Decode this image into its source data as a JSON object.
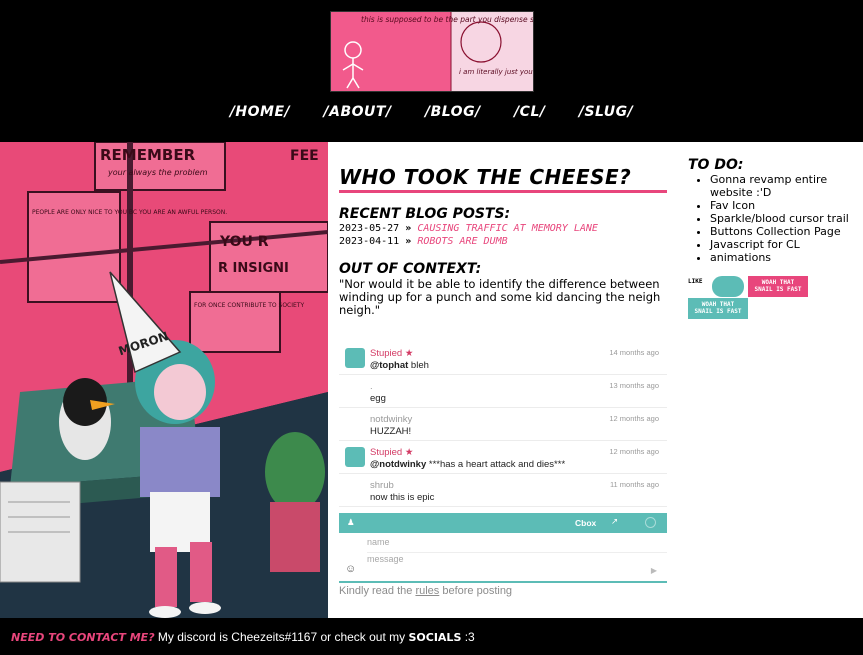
{
  "banner": {
    "caption_left": "this is supposed to be the part you dispense some sort of wisdom",
    "caption_right": "i am literally just you. fucking moron"
  },
  "nav": [
    "/HOME/",
    "/ABOUT/",
    "/BLOG/",
    "/CL/",
    "/SLUG/"
  ],
  "art": {
    "texts": [
      "REMEMBER",
      "your always the problem",
      "PEOPLE ARE ONLY NICE TO YOU BC YOU ARE AN AWFUL PERSON.",
      "YOU R",
      "R INSIGNI",
      "FOR ONCE CONTRIBUTE TO SOCIETY",
      "MORON",
      "FEE"
    ]
  },
  "page_title": "WHO TOOK THE CHEESE?",
  "recent_heading": "RECENT BLOG POSTS:",
  "posts": [
    {
      "date": "2023-05-27",
      "sep": "»",
      "title": "CAUSING TRAFFIC AT MEMORY LANE"
    },
    {
      "date": "2023-04-11",
      "sep": "»",
      "title": "ROBOTS ARE DUMB"
    }
  ],
  "ooc_heading": "OUT OF CONTEXT:",
  "ooc_quote": "\"Nor would it be able to identify the difference between winding up for a punch and some kid dancing the neigh neigh.\"",
  "chat": {
    "messages": [
      {
        "user": "Stupied",
        "admin": true,
        "time": "14 months ago",
        "mention": "@tophat",
        "text": " bleh"
      },
      {
        "user": ".",
        "admin": false,
        "time": "13 months ago",
        "mention": "",
        "text": "egg"
      },
      {
        "user": "notdwinky",
        "admin": false,
        "time": "12 months ago",
        "mention": "",
        "text": "HUZZAH!"
      },
      {
        "user": "Stupied",
        "admin": true,
        "time": "12 months ago",
        "mention": "@notdwinky",
        "text": " ***has a heart attack and dies***"
      },
      {
        "user": "shrub",
        "admin": false,
        "time": "11 months ago",
        "mention": "",
        "text": "now this is epic"
      }
    ],
    "brand": "Cbox",
    "name_placeholder": "name",
    "message_placeholder": "message",
    "notice_before": "Kindly read the ",
    "notice_link": "rules",
    "notice_after": " before posting",
    "accent": "#5cbcb6"
  },
  "todo": {
    "heading": "TO DO:",
    "items": [
      "Gonna revamp entire website :'D",
      "Fav Icon",
      "Sparkle/blood cursor trail",
      "Buttons Collection Page",
      "Javascript for CL",
      "animations"
    ]
  },
  "badges": [
    {
      "line1": "LIKE",
      "line2": ""
    },
    {
      "line1": "WOAH THAT",
      "line2": "SNAIL IS FAST"
    },
    {
      "line1": "WOAH THAT",
      "line2": "SNAIL IS FAST"
    }
  ],
  "footer": {
    "lead": "NEED TO CONTACT ME?",
    "text": " My discord is Cheezeits#1167 or check out my ",
    "link": "SOCIALS",
    "tail": " :3"
  },
  "colors": {
    "accent": "#e8467c",
    "teal": "#5cbcb6",
    "pink_art": "#f2507e"
  }
}
